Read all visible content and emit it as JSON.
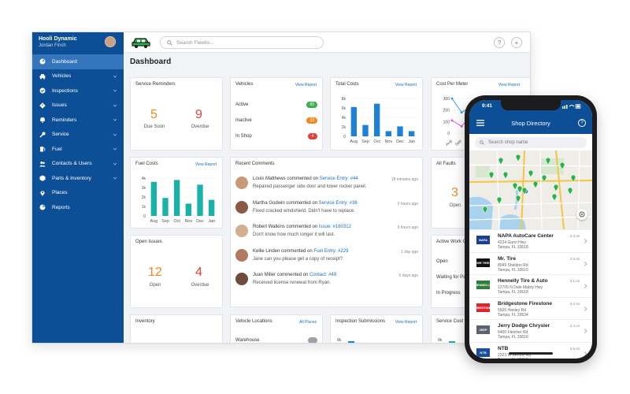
{
  "sidebar": {
    "org": "Hooli Dynamic",
    "user": "Jordan Finch",
    "items": [
      {
        "label": "Dashboard",
        "icon": "dashboard-icon"
      },
      {
        "label": "Vehicles",
        "icon": "car-icon"
      },
      {
        "label": "Inspections",
        "icon": "check-badge-icon"
      },
      {
        "label": "Issues",
        "icon": "warning-diamond-icon"
      },
      {
        "label": "Reminders",
        "icon": "bell-icon"
      },
      {
        "label": "Service",
        "icon": "wrench-icon"
      },
      {
        "label": "Fuel",
        "icon": "fuel-pump-icon"
      },
      {
        "label": "Contacts & Users",
        "icon": "people-icon"
      },
      {
        "label": "Parts & Inventory",
        "icon": "parts-box-icon"
      },
      {
        "label": "Places",
        "icon": "map-pin-icon"
      },
      {
        "label": "Reports",
        "icon": "pie-chart-icon"
      }
    ]
  },
  "topbar": {
    "search_placeholder": "Search Fleetio...",
    "help": "?",
    "add": "+"
  },
  "page": {
    "title": "Dashboard"
  },
  "cards": {
    "service_reminders": {
      "title": "Service Reminders",
      "due_soon": "5",
      "due_soon_label": "Due Soon",
      "overdue": "9",
      "overdue_label": "Overdue"
    },
    "vehicles": {
      "title": "Vehicles",
      "link": "View Report",
      "rows": [
        {
          "label": "Active",
          "count": "65"
        },
        {
          "label": "Inactive",
          "count": "13"
        },
        {
          "label": "In Shop",
          "count": "4"
        }
      ]
    },
    "total_costs": {
      "title": "Total Costs",
      "link": "View Report"
    },
    "cost_per_meter": {
      "title": "Cost Per Meter",
      "link": "View Report"
    },
    "fuel_costs": {
      "title": "Fuel Costs",
      "link": "View Report"
    },
    "recent_comments": {
      "title": "Recent Comments",
      "items": [
        {
          "author": "Louis Matthews",
          "verb": "commented on",
          "link": "Service Entry: #44",
          "text": "Repaired passenger side door and lower rocker panel.",
          "time": "18 minutes ago"
        },
        {
          "author": "Martha Godwin",
          "verb": "commented on",
          "link": "Service Entry: #36",
          "text": "Fixed cracked windshield. Didn't have to replace.",
          "time": "2 hours ago"
        },
        {
          "author": "Robert Watkins",
          "verb": "commented on",
          "link": "Issue: #160312",
          "text": "Don't know how much longer it will last.",
          "time": "3 hours ago"
        },
        {
          "author": "Kellie Linden",
          "verb": "commented on",
          "link": "Fuel Entry: #229",
          "text": "Jane can you please get a copy of receipt?",
          "time": "1 day ago"
        },
        {
          "author": "Juan Miller",
          "verb": "commented on",
          "link": "Contact: #49",
          "text": "Received license renewal from Ryan.",
          "time": "5 days ago"
        }
      ]
    },
    "all_faults": {
      "title": "All Faults",
      "open": "3",
      "open_label": "Open"
    },
    "open_issues": {
      "title": "Open Issues",
      "open": "12",
      "open_label": "Open",
      "overdue": "4",
      "overdue_label": "Overdue"
    },
    "active_work": {
      "title": "Active Work O",
      "rows": [
        "Open",
        "Waiting for Pa",
        "In Progress"
      ]
    },
    "inventory": {
      "title": "Inventory"
    },
    "vehicle_locations": {
      "title": "Vehicle Locations",
      "link": "All Places",
      "row_label": "Warehouse"
    },
    "inspection_submissions": {
      "title": "Inspection Submissions",
      "link": "View Report",
      "tick": "8k"
    },
    "service_costs": {
      "title": "Service Cost",
      "tick": "8k"
    }
  },
  "chart_data": [
    {
      "type": "bar",
      "title": "Total Costs",
      "categories": [
        "Aug",
        "Sep",
        "Oct",
        "Nov",
        "Dec",
        "Jan"
      ],
      "values": [
        6.2,
        2.4,
        6.9,
        1.1,
        2.1,
        1.1
      ],
      "yticks": [
        "0",
        "2k",
        "4k",
        "6k",
        "8k"
      ],
      "ylim": [
        0,
        8
      ],
      "color": "#1d82d6"
    },
    {
      "type": "bar",
      "title": "Fuel Costs",
      "categories": [
        "Aug",
        "Sep",
        "Oct",
        "Nov",
        "Dec",
        "Jan"
      ],
      "values": [
        3.6,
        1.9,
        3.8,
        1.3,
        3.3,
        1.7
      ],
      "yticks": [
        "0",
        "1k",
        "2k",
        "3k",
        "4k"
      ],
      "ylim": [
        0,
        4
      ],
      "color": "#19b2a6"
    },
    {
      "type": "line",
      "title": "Cost Per Meter",
      "yticks": [
        "0",
        "100",
        "200",
        "300"
      ],
      "categories": [
        "Aug",
        "Sep",
        "Oct",
        "Nov",
        "Dec",
        "Jan"
      ],
      "series": [
        {
          "values": [
            300,
            180,
            230,
            250,
            270,
            260
          ],
          "color": "#3aa0e8"
        },
        {
          "values": [
            110,
            60,
            150,
            120,
            140,
            130
          ],
          "color": "#e05ad3"
        }
      ]
    }
  ],
  "phone": {
    "time": "9:41",
    "title": "Shop Directory",
    "help": "?",
    "search_placeholder": "Search shop name",
    "shops": [
      {
        "name": "NAPA AutoCare Center",
        "addr1": "4224 Gunn Hwy",
        "addr2": "Tampa, FL 33618",
        "dist": "2.3 mi",
        "logo": "NAPA",
        "logo_color": "#1c3f8f"
      },
      {
        "name": "Mr. Tire",
        "addr1": "8049 Sheldon Rd",
        "addr2": "Tampa, FL 33615",
        "dist": "2.6 mi",
        "logo": "MR TIRE",
        "logo_color": "#111111"
      },
      {
        "name": "Hennelly Tire & Auto",
        "addr1": "12705 N Dale Mabry Hwy",
        "addr2": "Tampa, FL 33618",
        "dist": "3.1 mi",
        "logo": "HENNELLY",
        "logo_color": "#2e7d3a"
      },
      {
        "name": "Bridgestone Firestone",
        "addr1": "5505 Hanley Rd",
        "addr2": "Tampa, FL 33634",
        "dist": "3.2 mi",
        "logo": "FIRESTONE",
        "logo_color": "#d8262b"
      },
      {
        "name": "Jerry Dodge Chrysler",
        "addr1": "6400 Fletcher Rd",
        "addr2": "Tampa, FL 33618",
        "dist": "3.4 mi",
        "logo": "JEEP",
        "logo_color": "#5a6470"
      },
      {
        "name": "NTB",
        "addr1": "2323 W Benton Rd",
        "addr2": "Tampa, FL 33618",
        "dist": "3.5 mi",
        "logo": "NTB",
        "logo_color": "#1a4fa0"
      }
    ]
  }
}
